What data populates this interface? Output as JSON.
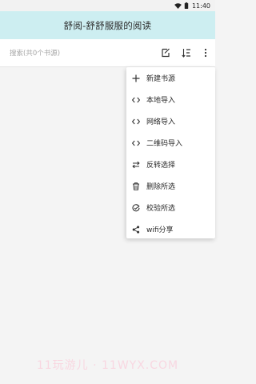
{
  "status_bar": {
    "time": "11:40",
    "icons": [
      "wifi-icon",
      "battery-icon"
    ]
  },
  "app_bar": {
    "title": "舒阅-舒舒服服的阅读",
    "background": "#cdeef1"
  },
  "toolbar": {
    "search_placeholder": "搜索(共0个书源)",
    "actions": [
      "edit-select-icon",
      "sort-icon",
      "more-vert-icon"
    ]
  },
  "menu": {
    "items": [
      {
        "label": "新建书源",
        "icon": "plus-icon"
      },
      {
        "label": "本地导入",
        "icon": "code-icon"
      },
      {
        "label": "网络导入",
        "icon": "code-icon"
      },
      {
        "label": "二维码导入",
        "icon": "code-icon"
      },
      {
        "label": "反转选择",
        "icon": "swap-icon"
      },
      {
        "label": "删除所选",
        "icon": "trash-icon"
      },
      {
        "label": "校验所选",
        "icon": "verify-icon"
      },
      {
        "label": "wifi分享",
        "icon": "share-icon"
      }
    ]
  },
  "watermark": "11玩游儿 · 11WYX.COM"
}
